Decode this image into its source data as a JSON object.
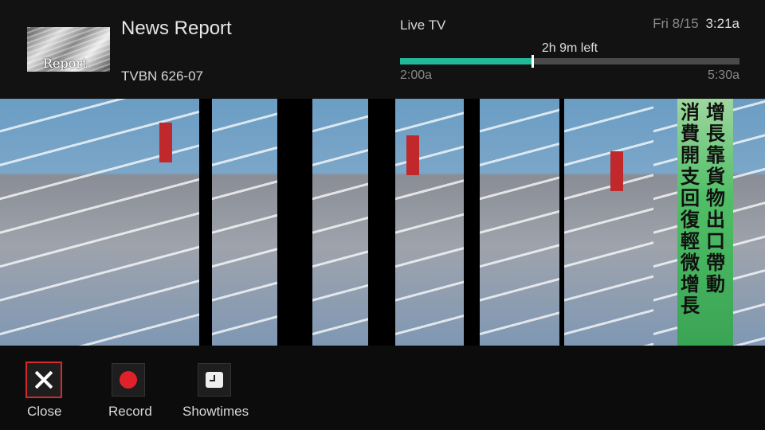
{
  "program": {
    "title": "News Report",
    "channel": "TVBN 626-07",
    "thumbnail_text": "Report"
  },
  "status": {
    "live_label": "Live TV",
    "date": "Fri 8/15",
    "time": "3:21a"
  },
  "progress": {
    "remaining_label": "2h 9m left",
    "start_time": "2:00a",
    "end_time": "5:30a",
    "fraction": 0.39,
    "fill_color": "#22b89a"
  },
  "video": {
    "overlay_text": [
      "增長靠貨物出口帶動",
      "消費開支回復輕微增長"
    ]
  },
  "controls": [
    {
      "label": "Close",
      "icon": "close-icon",
      "focused": true
    },
    {
      "label": "Record",
      "icon": "record-icon",
      "focused": false
    },
    {
      "label": "Showtimes",
      "icon": "clock-icon",
      "focused": false
    }
  ],
  "colors": {
    "focus_border": "#d42a2a",
    "record": "#e0212b"
  }
}
